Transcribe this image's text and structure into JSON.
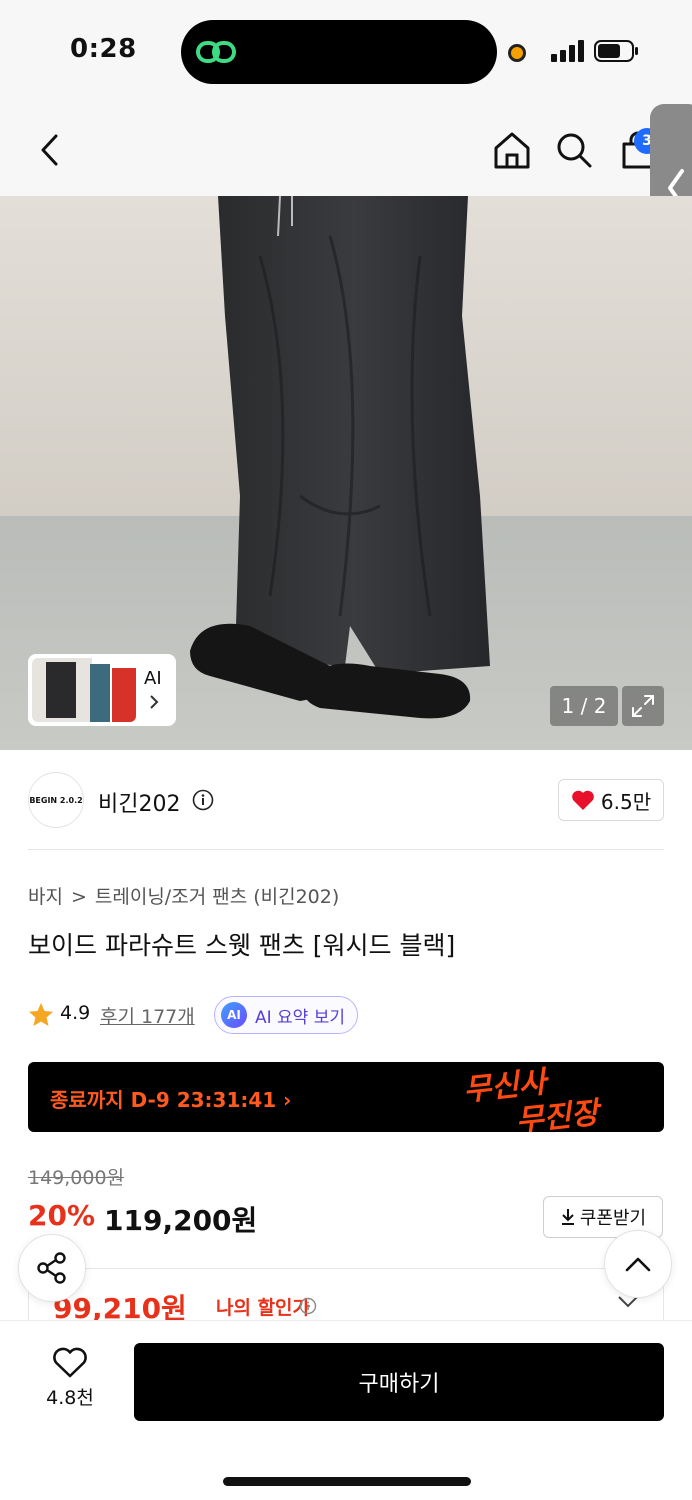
{
  "status_bar": {
    "time": "0:28"
  },
  "header": {
    "back_icon": "chevron-left-icon",
    "home_icon": "home-icon",
    "search_icon": "search-icon",
    "cart_icon": "shopping-bag-icon",
    "cart_badge": "3"
  },
  "gallery": {
    "counter": "1 / 2",
    "thumb_label": "AI",
    "expand_icon": "expand-icon"
  },
  "brand": {
    "logo_text": "BEGIN 2.0.2",
    "name": "비긴202",
    "likes": "6.5만"
  },
  "product": {
    "breadcrumb": [
      "바지",
      "트레이닝/조거 팬츠 (비긴202)"
    ],
    "title": "보이드 파라슈트 스웻 팬츠 [워시드 블랙]",
    "rating": "4.9",
    "reviews": "후기 177개",
    "ai_badge": "AI",
    "ai_summary": "AI 요약 보기"
  },
  "promo": {
    "countdown": "종료까지 D-9 23:31:41",
    "logo_line1": "무신사",
    "logo_line2": "무진장"
  },
  "price": {
    "original": "149,000원",
    "discount": "20%",
    "sale": "119,200원",
    "coupon_label": "쿠폰받기",
    "my_price": "99,210원",
    "my_price_label": "나의 할인가"
  },
  "bottom": {
    "wish_count": "4.8천",
    "buy_label": "구매하기"
  },
  "colors": {
    "accent_red": "#e8311a",
    "promo_orange": "#ff5a1f",
    "badge_blue": "#1f6bff",
    "ai_purple": "#5a3fd6"
  }
}
